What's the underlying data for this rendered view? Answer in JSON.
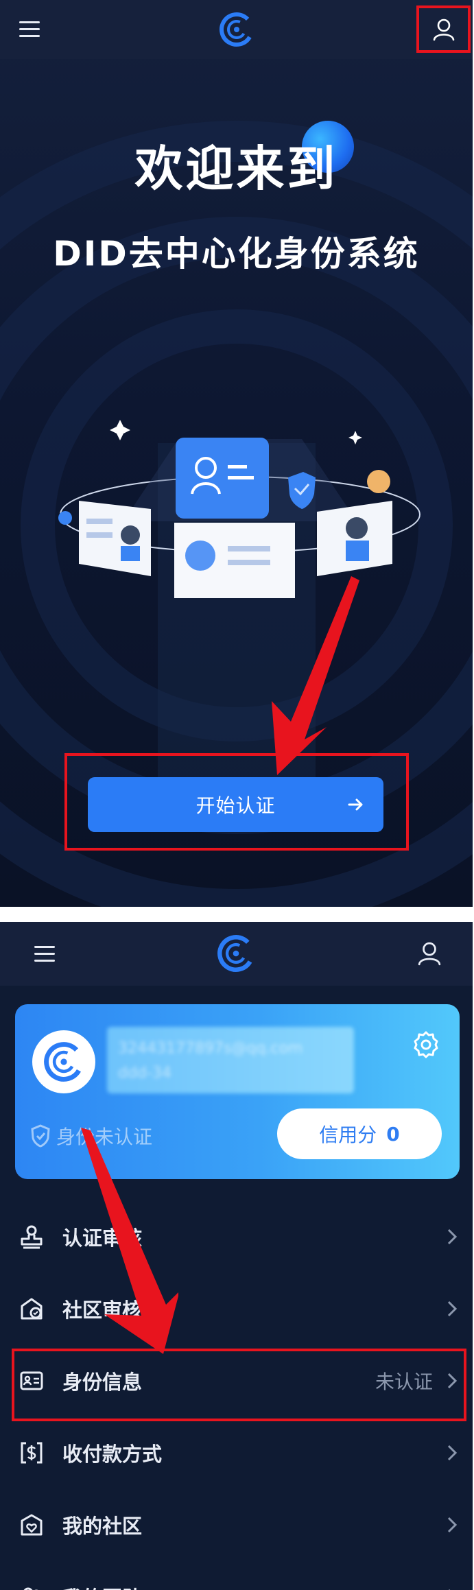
{
  "screen1": {
    "welcome": "欢迎来到",
    "subtitle": "DID去中心化身份系统",
    "start_button": "开始认证",
    "icons": {
      "menu": "hamburger-icon",
      "logo": "app-logo",
      "user": "user-icon",
      "arrow": "arrow-right-icon"
    }
  },
  "screen2": {
    "profile": {
      "account_line1": "32443177897s@qq.com",
      "account_line2": "ddd-34",
      "id_status": "身份未认证",
      "credit_label": "信用分",
      "credit_value": "0"
    },
    "menu": [
      {
        "label": "认证审核",
        "value": "",
        "icon": "stamp-icon"
      },
      {
        "label": "社区审核",
        "value": "",
        "icon": "community-review-icon"
      },
      {
        "label": "身份信息",
        "value": "未认证",
        "icon": "id-card-icon"
      },
      {
        "label": "收付款方式",
        "value": "",
        "icon": "payment-icon"
      },
      {
        "label": "我的社区",
        "value": "",
        "icon": "my-community-icon"
      },
      {
        "label": "我的团队",
        "value": "",
        "icon": "team-icon"
      }
    ]
  },
  "colors": {
    "background": "#0f1b33",
    "primary": "#2b7cf6",
    "highlight_red": "#e8141e"
  }
}
